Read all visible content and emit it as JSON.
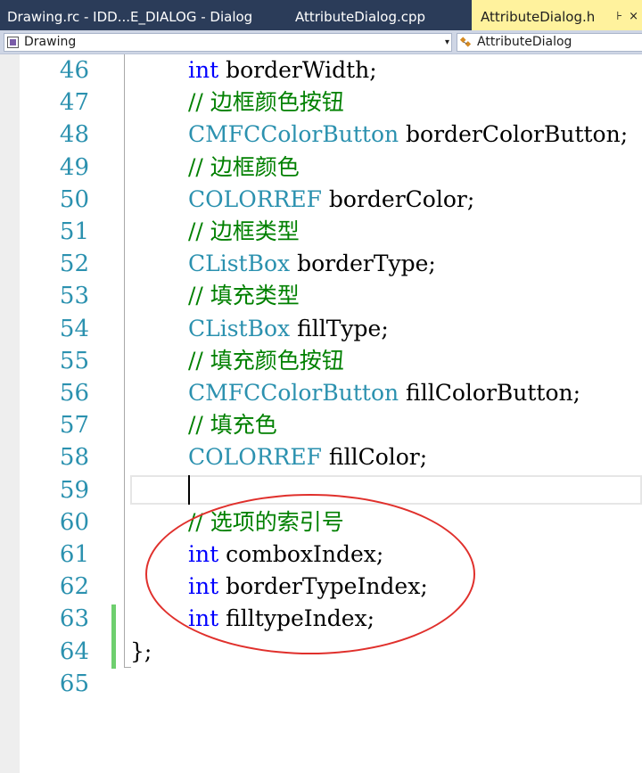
{
  "tabs": [
    {
      "label": "Drawing.rc - IDD...E_DIALOG - Dialog"
    },
    {
      "label": "AttributeDialog.cpp"
    },
    {
      "label": "AttributeDialog.h",
      "active": true,
      "pin": "⊦",
      "close": "×"
    }
  ],
  "navbar": {
    "scope": "Drawing",
    "member": "AttributeDialog",
    "dropdown_arrow": "▾",
    "scope_icon": "project-icon",
    "member_icon": "class-icon"
  },
  "editor": {
    "line_numbers": [
      "46",
      "47",
      "48",
      "49",
      "50",
      "51",
      "52",
      "53",
      "54",
      "55",
      "56",
      "57",
      "58",
      "59",
      "60",
      "61",
      "62",
      "63",
      "64",
      "65"
    ],
    "lines": [
      [
        {
          "t": "int",
          "c": "kw"
        },
        {
          "t": " borderWidth;",
          "c": "pl"
        }
      ],
      [
        {
          "t": "// 边框颜色按钮",
          "c": "cm"
        }
      ],
      [
        {
          "t": "CMFCColorButton",
          "c": "ty"
        },
        {
          "t": " borderColorButton;",
          "c": "pl"
        }
      ],
      [
        {
          "t": "// 边框颜色",
          "c": "cm"
        }
      ],
      [
        {
          "t": "COLORREF",
          "c": "ty"
        },
        {
          "t": " borderColor;",
          "c": "pl"
        }
      ],
      [
        {
          "t": "// 边框类型",
          "c": "cm"
        }
      ],
      [
        {
          "t": "CListBox",
          "c": "ty"
        },
        {
          "t": " borderType;",
          "c": "pl"
        }
      ],
      [
        {
          "t": "// 填充类型",
          "c": "cm"
        }
      ],
      [
        {
          "t": "CListBox",
          "c": "ty"
        },
        {
          "t": " fillType;",
          "c": "pl"
        }
      ],
      [
        {
          "t": "// 填充颜色按钮",
          "c": "cm"
        }
      ],
      [
        {
          "t": "CMFCColorButton",
          "c": "ty"
        },
        {
          "t": " fillColorButton;",
          "c": "pl"
        }
      ],
      [
        {
          "t": "// 填充色",
          "c": "cm"
        }
      ],
      [
        {
          "t": "COLORREF",
          "c": "ty"
        },
        {
          "t": " fillColor;",
          "c": "pl"
        }
      ],
      [],
      [
        {
          "t": "// 选项的索引号",
          "c": "cm"
        }
      ],
      [
        {
          "t": "int",
          "c": "kw"
        },
        {
          "t": " comboxIndex;",
          "c": "pl"
        }
      ],
      [
        {
          "t": "int",
          "c": "kw"
        },
        {
          "t": " borderTypeIndex;",
          "c": "pl"
        }
      ],
      [
        {
          "t": "int",
          "c": "kw"
        },
        {
          "t": " filltypeIndex;",
          "c": "pl"
        }
      ],
      [
        {
          "t": "};",
          "c": "pl"
        }
      ],
      []
    ],
    "colors": {
      "keyword": "#0000ff",
      "type": "#2b91af",
      "comment": "#008000",
      "line_number": "#2b91af",
      "change_marker": "#6ecf6e",
      "annotation_circle": "#e0302c",
      "tab_active": "#fff29d",
      "tab_strip": "#2b3c59"
    }
  }
}
